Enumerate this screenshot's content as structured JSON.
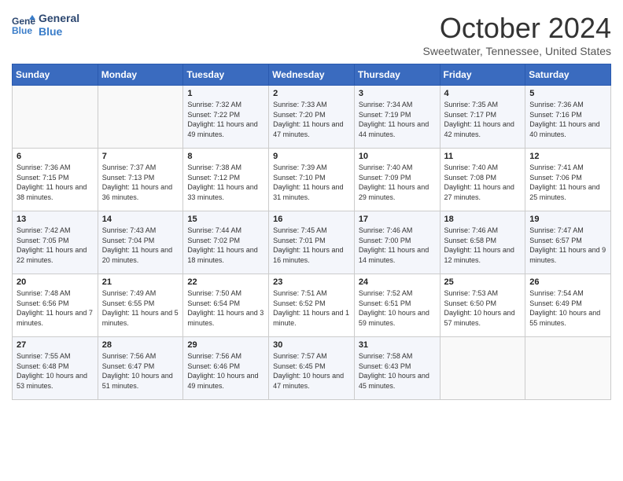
{
  "header": {
    "logo_line1": "General",
    "logo_line2": "Blue",
    "month": "October 2024",
    "location": "Sweetwater, Tennessee, United States"
  },
  "weekdays": [
    "Sunday",
    "Monday",
    "Tuesday",
    "Wednesday",
    "Thursday",
    "Friday",
    "Saturday"
  ],
  "weeks": [
    [
      {
        "day": "",
        "info": ""
      },
      {
        "day": "",
        "info": ""
      },
      {
        "day": "1",
        "info": "Sunrise: 7:32 AM\nSunset: 7:22 PM\nDaylight: 11 hours and 49 minutes."
      },
      {
        "day": "2",
        "info": "Sunrise: 7:33 AM\nSunset: 7:20 PM\nDaylight: 11 hours and 47 minutes."
      },
      {
        "day": "3",
        "info": "Sunrise: 7:34 AM\nSunset: 7:19 PM\nDaylight: 11 hours and 44 minutes."
      },
      {
        "day": "4",
        "info": "Sunrise: 7:35 AM\nSunset: 7:17 PM\nDaylight: 11 hours and 42 minutes."
      },
      {
        "day": "5",
        "info": "Sunrise: 7:36 AM\nSunset: 7:16 PM\nDaylight: 11 hours and 40 minutes."
      }
    ],
    [
      {
        "day": "6",
        "info": "Sunrise: 7:36 AM\nSunset: 7:15 PM\nDaylight: 11 hours and 38 minutes."
      },
      {
        "day": "7",
        "info": "Sunrise: 7:37 AM\nSunset: 7:13 PM\nDaylight: 11 hours and 36 minutes."
      },
      {
        "day": "8",
        "info": "Sunrise: 7:38 AM\nSunset: 7:12 PM\nDaylight: 11 hours and 33 minutes."
      },
      {
        "day": "9",
        "info": "Sunrise: 7:39 AM\nSunset: 7:10 PM\nDaylight: 11 hours and 31 minutes."
      },
      {
        "day": "10",
        "info": "Sunrise: 7:40 AM\nSunset: 7:09 PM\nDaylight: 11 hours and 29 minutes."
      },
      {
        "day": "11",
        "info": "Sunrise: 7:40 AM\nSunset: 7:08 PM\nDaylight: 11 hours and 27 minutes."
      },
      {
        "day": "12",
        "info": "Sunrise: 7:41 AM\nSunset: 7:06 PM\nDaylight: 11 hours and 25 minutes."
      }
    ],
    [
      {
        "day": "13",
        "info": "Sunrise: 7:42 AM\nSunset: 7:05 PM\nDaylight: 11 hours and 22 minutes."
      },
      {
        "day": "14",
        "info": "Sunrise: 7:43 AM\nSunset: 7:04 PM\nDaylight: 11 hours and 20 minutes."
      },
      {
        "day": "15",
        "info": "Sunrise: 7:44 AM\nSunset: 7:02 PM\nDaylight: 11 hours and 18 minutes."
      },
      {
        "day": "16",
        "info": "Sunrise: 7:45 AM\nSunset: 7:01 PM\nDaylight: 11 hours and 16 minutes."
      },
      {
        "day": "17",
        "info": "Sunrise: 7:46 AM\nSunset: 7:00 PM\nDaylight: 11 hours and 14 minutes."
      },
      {
        "day": "18",
        "info": "Sunrise: 7:46 AM\nSunset: 6:58 PM\nDaylight: 11 hours and 12 minutes."
      },
      {
        "day": "19",
        "info": "Sunrise: 7:47 AM\nSunset: 6:57 PM\nDaylight: 11 hours and 9 minutes."
      }
    ],
    [
      {
        "day": "20",
        "info": "Sunrise: 7:48 AM\nSunset: 6:56 PM\nDaylight: 11 hours and 7 minutes."
      },
      {
        "day": "21",
        "info": "Sunrise: 7:49 AM\nSunset: 6:55 PM\nDaylight: 11 hours and 5 minutes."
      },
      {
        "day": "22",
        "info": "Sunrise: 7:50 AM\nSunset: 6:54 PM\nDaylight: 11 hours and 3 minutes."
      },
      {
        "day": "23",
        "info": "Sunrise: 7:51 AM\nSunset: 6:52 PM\nDaylight: 11 hours and 1 minute."
      },
      {
        "day": "24",
        "info": "Sunrise: 7:52 AM\nSunset: 6:51 PM\nDaylight: 10 hours and 59 minutes."
      },
      {
        "day": "25",
        "info": "Sunrise: 7:53 AM\nSunset: 6:50 PM\nDaylight: 10 hours and 57 minutes."
      },
      {
        "day": "26",
        "info": "Sunrise: 7:54 AM\nSunset: 6:49 PM\nDaylight: 10 hours and 55 minutes."
      }
    ],
    [
      {
        "day": "27",
        "info": "Sunrise: 7:55 AM\nSunset: 6:48 PM\nDaylight: 10 hours and 53 minutes."
      },
      {
        "day": "28",
        "info": "Sunrise: 7:56 AM\nSunset: 6:47 PM\nDaylight: 10 hours and 51 minutes."
      },
      {
        "day": "29",
        "info": "Sunrise: 7:56 AM\nSunset: 6:46 PM\nDaylight: 10 hours and 49 minutes."
      },
      {
        "day": "30",
        "info": "Sunrise: 7:57 AM\nSunset: 6:45 PM\nDaylight: 10 hours and 47 minutes."
      },
      {
        "day": "31",
        "info": "Sunrise: 7:58 AM\nSunset: 6:43 PM\nDaylight: 10 hours and 45 minutes."
      },
      {
        "day": "",
        "info": ""
      },
      {
        "day": "",
        "info": ""
      }
    ]
  ]
}
